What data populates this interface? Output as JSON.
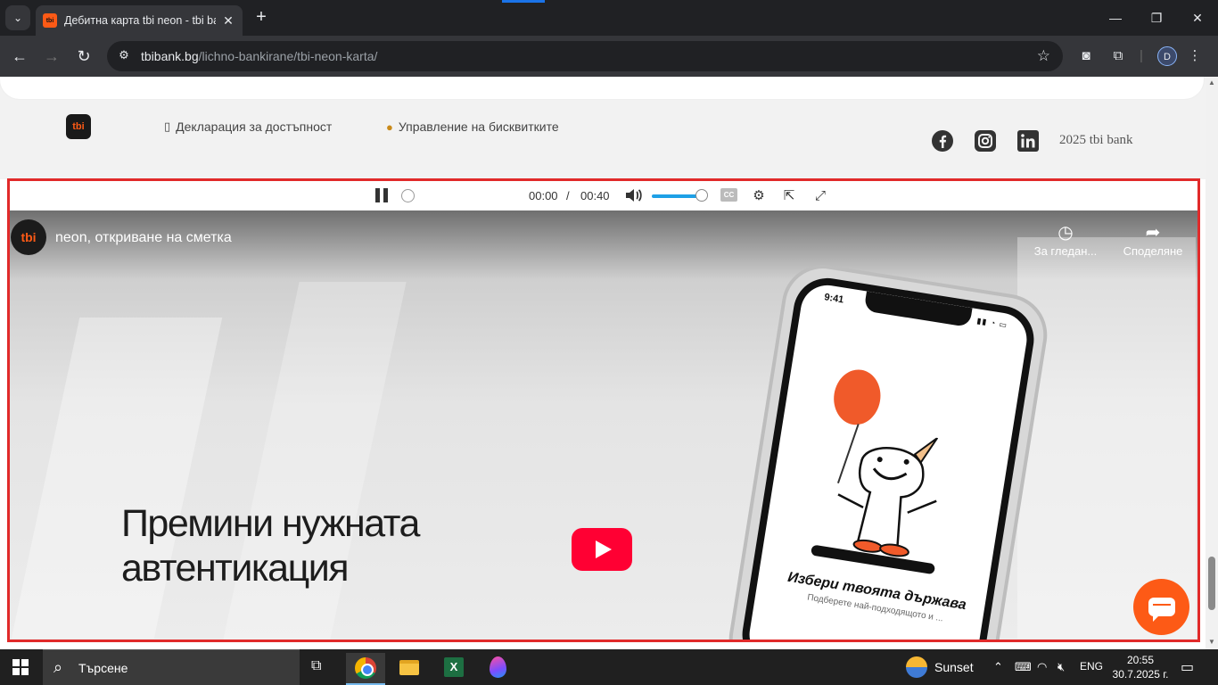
{
  "browser": {
    "tab_title": "Дебитна карта tbi neon - tbi bank",
    "favicon_text": "tbi",
    "url_host": "tbibank.bg",
    "url_path": "/lichno-bankirane/tbi-neon-karta/",
    "profile_initial": "D"
  },
  "footer": {
    "logo_text": "tbi",
    "accessibility_link": "Декларация за достъпност",
    "cookies_link": "Управление на бисквитките",
    "copyright": "2025 tbi bank"
  },
  "player": {
    "current_time": "00:00",
    "separator": "/",
    "duration": "00:40",
    "volume_level": 0.85,
    "cc_label": "CC"
  },
  "video": {
    "channel_avatar_text": "tbi",
    "title": "neon, откриване на сметка",
    "watch_later_label": "За гледан...",
    "share_label": "Споделяне",
    "headline_line1": "Премини нужната",
    "headline_line2": "автентикация",
    "phone_time": "9:41",
    "phone_heading": "Избери твоята държава",
    "phone_subtext": "Подберете най-подходящото и ..."
  },
  "taskbar": {
    "search_placeholder": "Търсене",
    "weather_label": "Sunset",
    "language": "ENG",
    "time": "20:55",
    "date": "30.7.2025 г."
  },
  "colors": {
    "brand_orange": "#fd5a16",
    "highlight_border": "#e12a2a",
    "youtube_red": "#ff0033",
    "volume_blue": "#1ea0e6"
  }
}
